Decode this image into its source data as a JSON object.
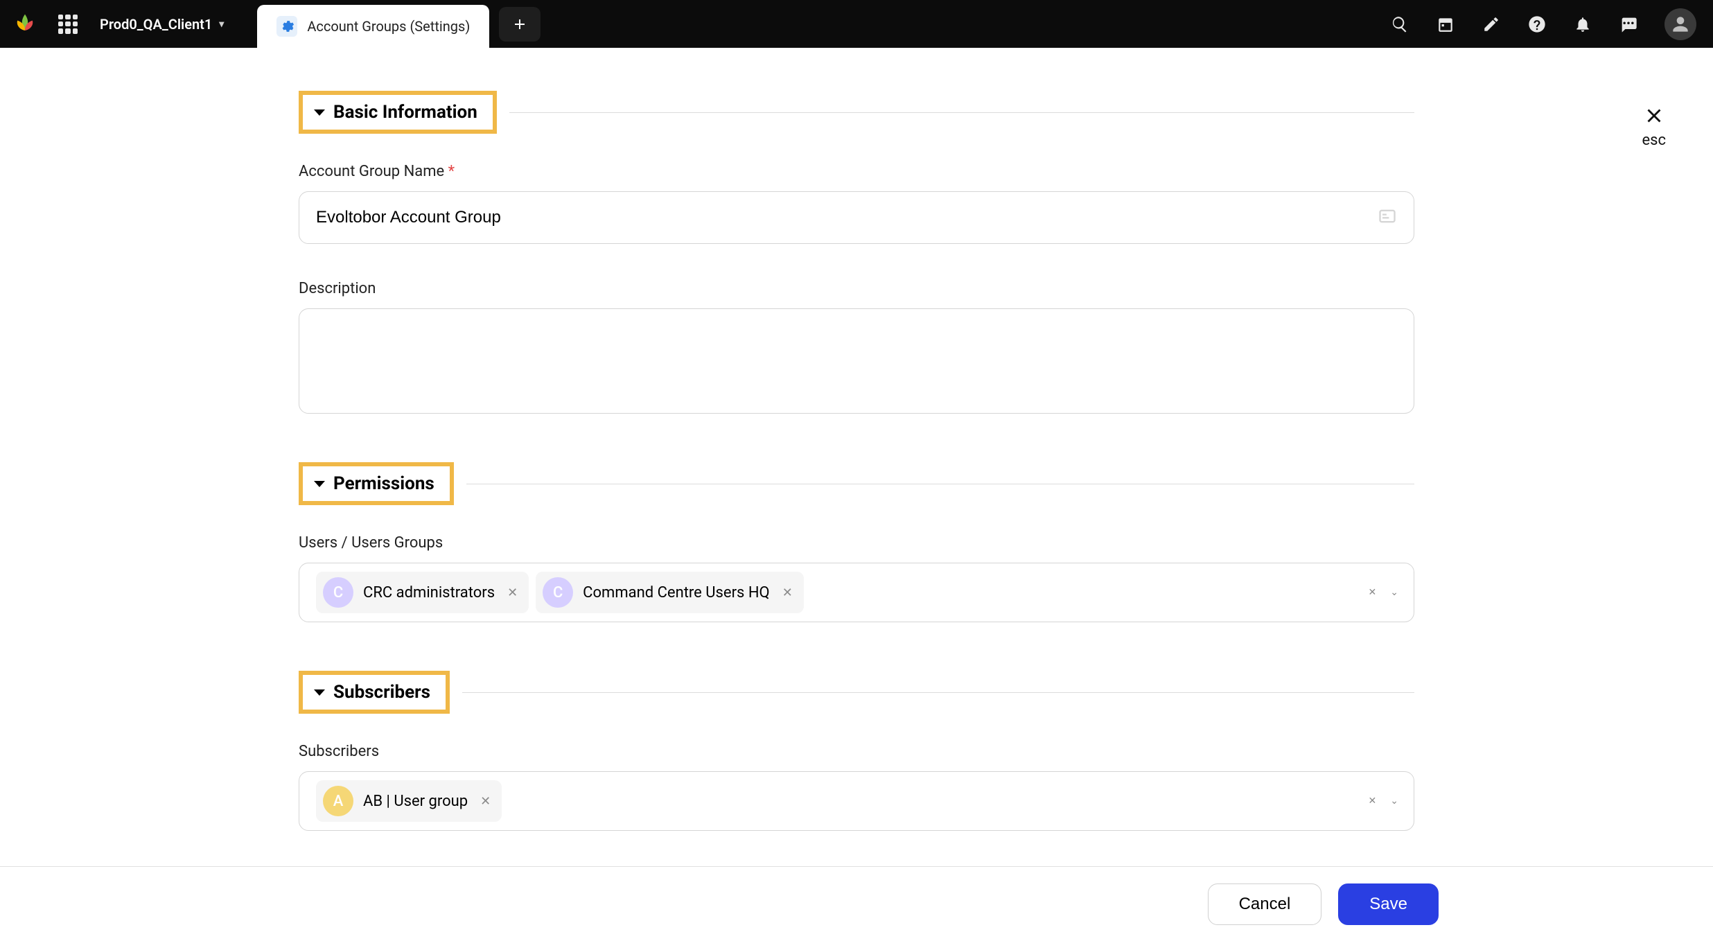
{
  "header": {
    "workspace_name": "Prod0_QA_Client1",
    "tab_label": "Account Groups (Settings)"
  },
  "close": {
    "esc_label": "esc"
  },
  "sections": {
    "basic_info": {
      "title": "Basic Information",
      "fields": {
        "name": {
          "label": "Account Group Name",
          "required_marker": "*",
          "value": "Evoltobor Account Group"
        },
        "description": {
          "label": "Description",
          "value": ""
        }
      }
    },
    "permissions": {
      "title": "Permissions",
      "fields": {
        "users_groups": {
          "label": "Users / Users Groups",
          "tags": [
            {
              "badge_letter": "C",
              "label": "CRC administrators",
              "badge_color": "purple"
            },
            {
              "badge_letter": "C",
              "label": "Command Centre Users HQ",
              "badge_color": "purple"
            }
          ]
        }
      }
    },
    "subscribers": {
      "title": "Subscribers",
      "fields": {
        "subscribers": {
          "label": "Subscribers",
          "tags": [
            {
              "badge_letter": "A",
              "label": "AB | User group",
              "badge_color": "yellow"
            }
          ]
        }
      }
    }
  },
  "footer": {
    "cancel_label": "Cancel",
    "save_label": "Save"
  }
}
